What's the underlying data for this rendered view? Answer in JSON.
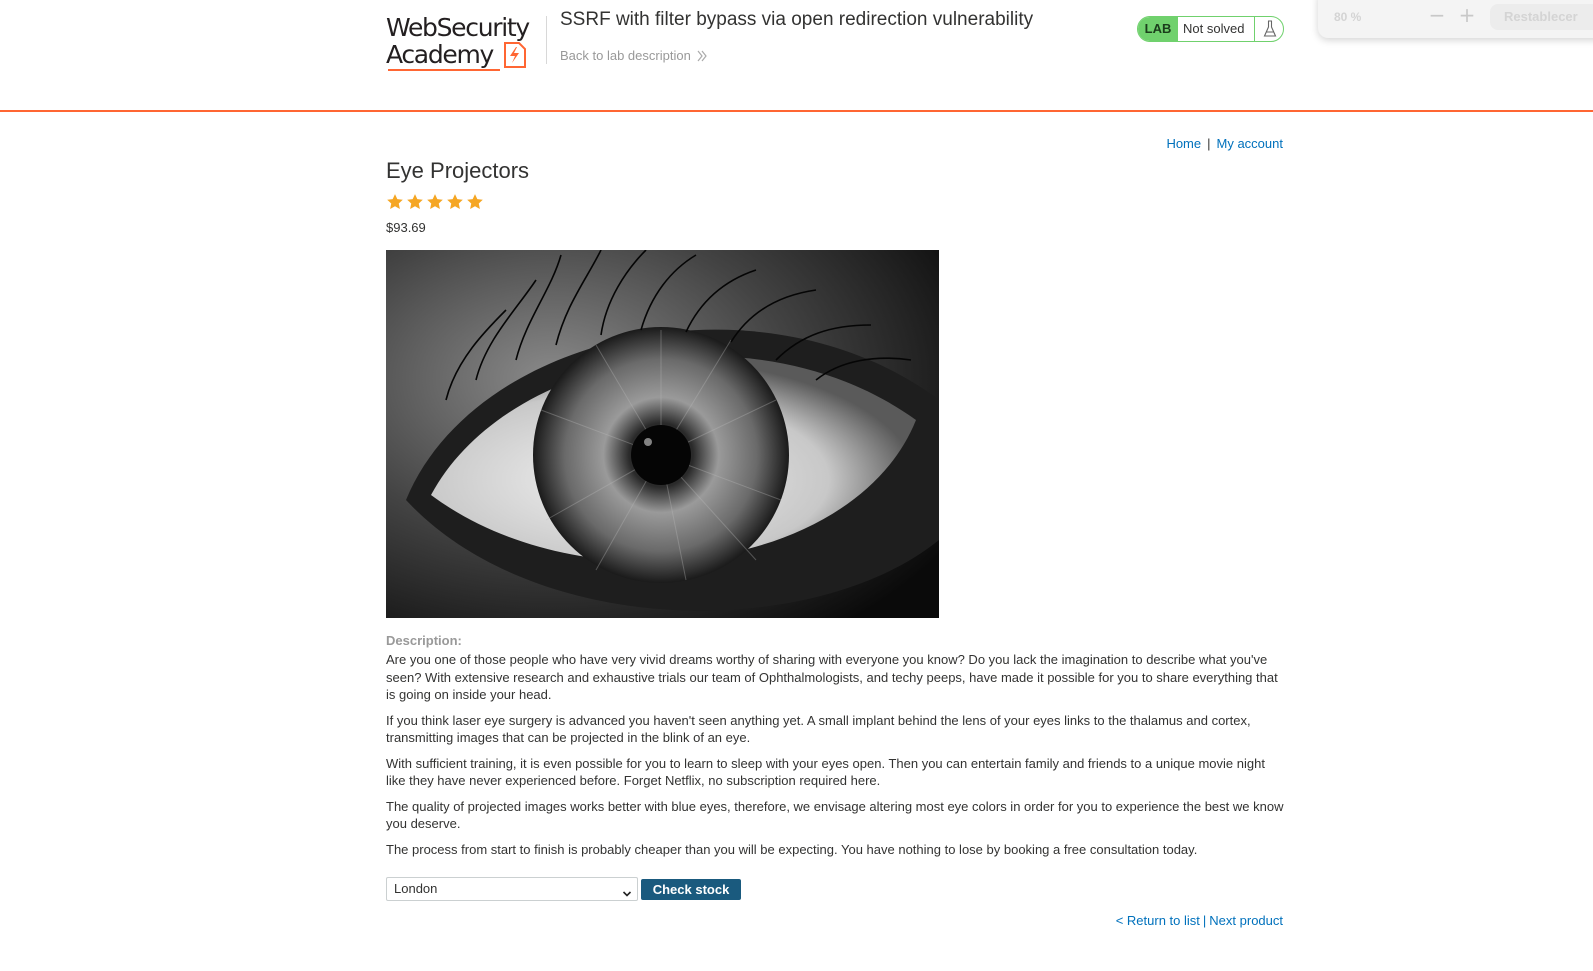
{
  "header": {
    "logo": {
      "line1": "WebSecurity",
      "line2": "Academy"
    },
    "lab_title": "SSRF with filter bypass via open redirection vulnerability",
    "back_link": "Back to lab description",
    "lab_badge": "LAB",
    "lab_status": "Not solved"
  },
  "zoom_toolbar": {
    "level": "80 %",
    "reset_label": "Restablecer"
  },
  "nav": {
    "home": "Home",
    "separator": "|",
    "my_account": "My account"
  },
  "product": {
    "title": "Eye Projectors",
    "rating_stars": 5,
    "rating_max": 5,
    "price": "$93.69",
    "description_label": "Description:",
    "description": [
      "Are you one of those people who have very vivid dreams worthy of sharing with everyone you know? Do you lack the imagination to describe what you've seen? With extensive research and exhaustive trials our team of Ophthalmologists, and techy peeps, have made it possible for you to share everything that is going on inside your head.",
      "If you think laser eye surgery is advanced you haven't seen anything yet. A small implant behind the lens of your eyes links to the thalamus and cortex, transmitting images that can be projected in the blink of an eye.",
      "With sufficient training, it is even possible for you to learn to sleep with your eyes open. Then you can entertain family and friends to a unique movie night like they have never experienced before. Forget Netflix, no subscription required here.",
      "The quality of projected images works better with blue eyes, therefore, we envisage altering most eye colors in order for you to experience the best we know you deserve.",
      "The process from start to finish is probably cheaper than you will be expecting. You have nothing to lose by booking a free consultation today."
    ]
  },
  "stock_check": {
    "selected_store": "London",
    "button_label": "Check stock"
  },
  "footer_nav": {
    "return_link": "< Return to list",
    "separator": "|",
    "next_link": "Next product"
  },
  "colors": {
    "accent_orange": "#ff6633",
    "lab_green": "#70d16d",
    "link_blue": "#0071bc",
    "button_blue": "#1a5a7e",
    "star_orange": "#f5a623"
  },
  "icons": {
    "back_chevron": "double-chevron-right-icon",
    "lab_flask": "flask-icon",
    "star": "star-icon",
    "select_caret": "chevron-down-icon"
  }
}
